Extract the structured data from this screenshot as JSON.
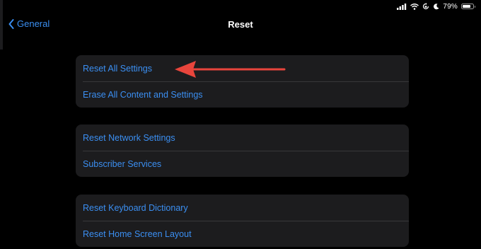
{
  "status_bar": {
    "battery_percent": "79%",
    "battery_level": 0.79,
    "icons": [
      "cellular-signal-icon",
      "wifi-icon",
      "screen-orientation-lock-icon",
      "do-not-disturb-moon-icon",
      "battery-icon"
    ]
  },
  "nav": {
    "back_label": "General",
    "title": "Reset"
  },
  "groups": [
    {
      "items": [
        "Reset All Settings",
        "Erase All Content and Settings"
      ]
    },
    {
      "items": [
        "Reset Network Settings",
        "Subscriber Services"
      ]
    },
    {
      "items": [
        "Reset Keyboard Dictionary",
        "Reset Home Screen Layout"
      ]
    }
  ],
  "annotation": {
    "type": "arrow",
    "color": "#e8453c",
    "points_to": "Reset All Settings"
  },
  "colors": {
    "background": "#000000",
    "group_background": "#1c1c1e",
    "accent": "#3b8ff2",
    "separator": "#38383a"
  }
}
